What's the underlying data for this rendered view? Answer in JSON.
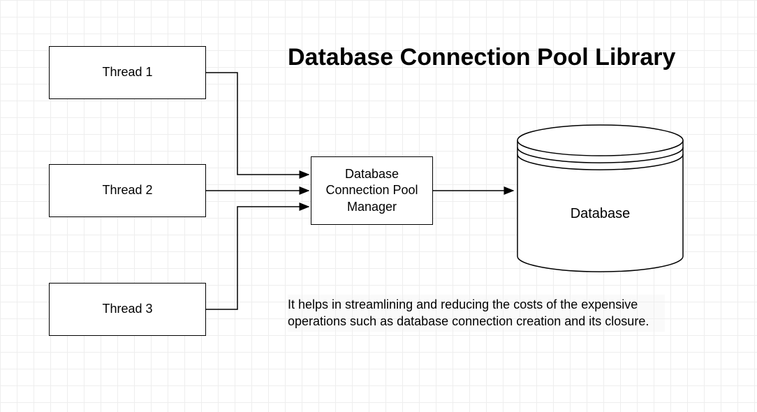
{
  "title": "Database Connection Pool Library",
  "threads": [
    {
      "label": "Thread 1"
    },
    {
      "label": "Thread 2"
    },
    {
      "label": "Thread 3"
    }
  ],
  "manager": {
    "label": "Database Connection Pool Manager"
  },
  "database": {
    "label": "Database"
  },
  "description": "It helps in streamlining and reducing the costs of the expensive operations such as database connection creation and its closure."
}
